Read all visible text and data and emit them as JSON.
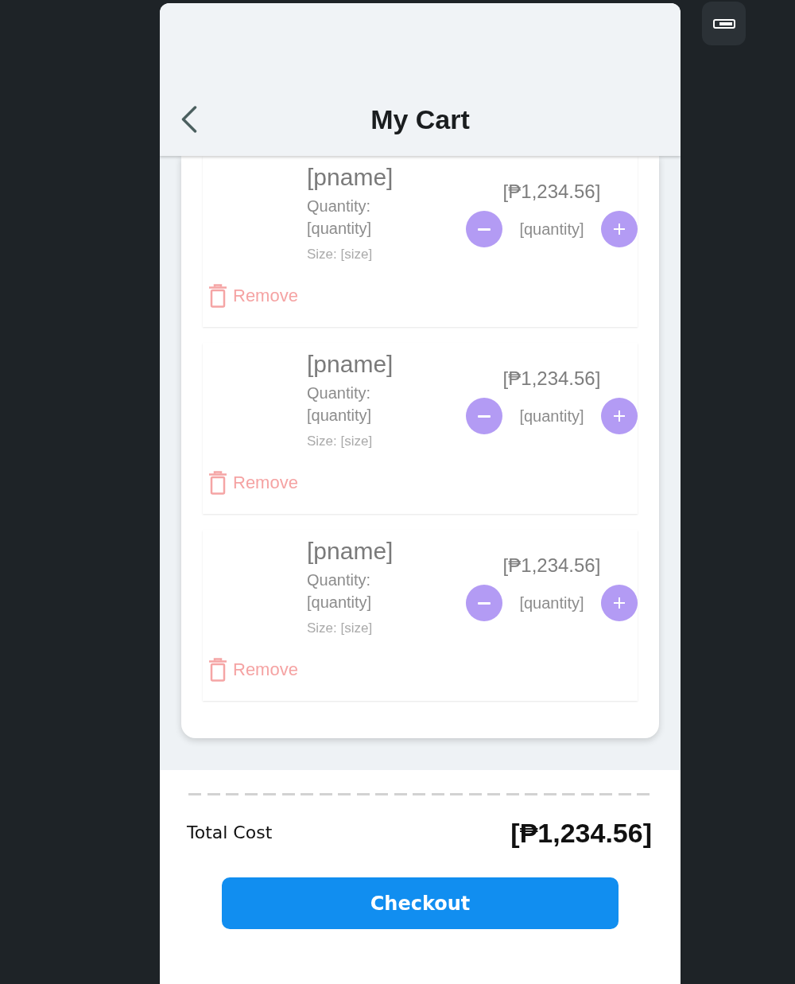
{
  "header": {
    "title": "My Cart"
  },
  "cart_items": [
    {
      "name": "[pname]",
      "quantity_label": "Quantity:",
      "quantity": "[quantity]",
      "size": "Size: [size]",
      "price": "[₱1,234.56]",
      "stepper_value": "[quantity]",
      "remove_label": "Remove"
    },
    {
      "name": "[pname]",
      "quantity_label": "Quantity:",
      "quantity": "[quantity]",
      "size": "Size: [size]",
      "price": "[₱1,234.56]",
      "stepper_value": "[quantity]",
      "remove_label": "Remove"
    },
    {
      "name": "[pname]",
      "quantity_label": "Quantity:",
      "quantity": "[quantity]",
      "size": "Size: [size]",
      "price": "[₱1,234.56]",
      "stepper_value": "[quantity]",
      "remove_label": "Remove"
    }
  ],
  "summary": {
    "total_label": "Total Cost",
    "total": "[₱1,234.56]"
  },
  "checkout_button": {
    "label": "Checkout"
  }
}
